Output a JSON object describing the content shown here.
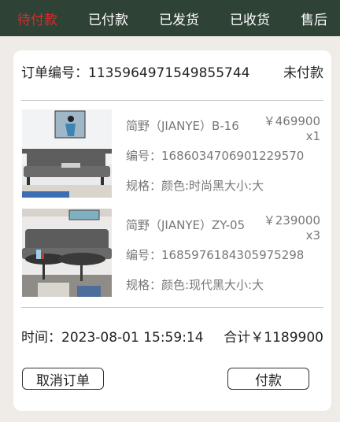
{
  "tabs": [
    {
      "label": "待付款",
      "active": true
    },
    {
      "label": "已付款"
    },
    {
      "label": "已发货"
    },
    {
      "label": "已收货"
    },
    {
      "label": "售后"
    }
  ],
  "order": {
    "number_label": "订单编号：1135964971549855744",
    "status": "未付款",
    "items": [
      {
        "name": "简野（JIANYE）B-16",
        "price": "￥469900",
        "qty": "x1",
        "code": "编号：1686034706901229570",
        "spec": "规格：颜色:时尚黑大小:大"
      },
      {
        "name": "简野（JIANYE）ZY-05",
        "price": "￥239000",
        "qty": "x3",
        "code": "编号：1685976184305975298",
        "spec": "规格：颜色:现代黑大小:大"
      }
    ],
    "time": "时间：2023-08-01 15:59:14",
    "total": "合计￥1189900"
  },
  "actions": {
    "cancel_label": "取消订单",
    "pay_label": "付款"
  },
  "colors": {
    "header_bg": "#2f4236",
    "active_tab": "#e02a2a",
    "page_bg": "#efebe6"
  }
}
